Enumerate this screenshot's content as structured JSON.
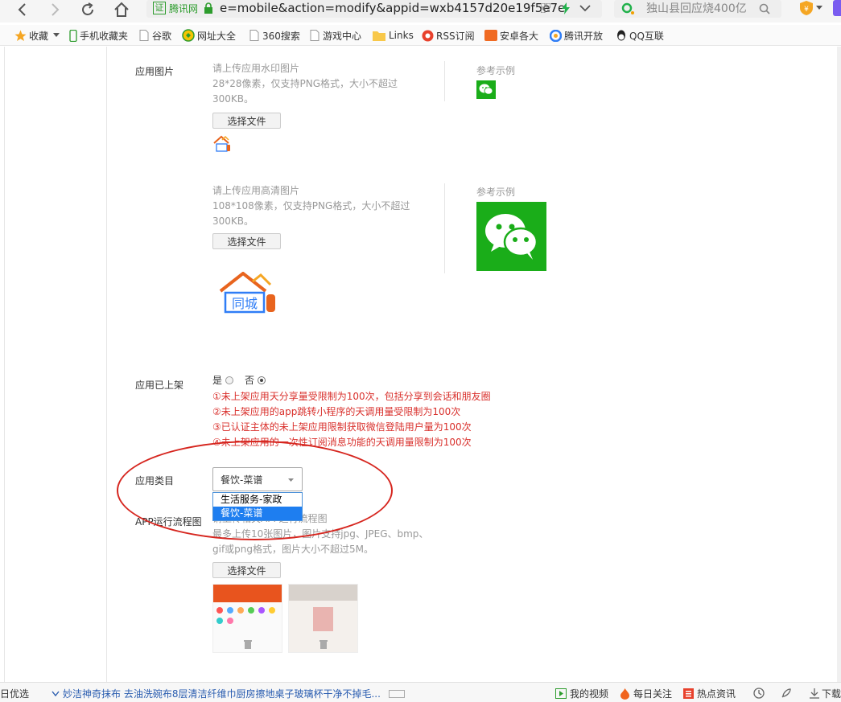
{
  "toolbar": {
    "address_cert_label": "证",
    "address_site": "腾讯网",
    "address_url": "e=mobile&action=modify&appid=wxb4157d20e19f5e7e",
    "search_text": "独山县回应烧400亿"
  },
  "bookmarks": [
    {
      "label": "收藏",
      "icon": "star-icon"
    },
    {
      "label": "手机收藏夹",
      "icon": "phone-icon"
    },
    {
      "label": "谷歌",
      "icon": "page-icon"
    },
    {
      "label": "网址大全",
      "icon": "globe-icon"
    },
    {
      "label": "360搜索",
      "icon": "page-icon"
    },
    {
      "label": "游戏中心",
      "icon": "page-icon"
    },
    {
      "label": "Links",
      "icon": "folder-icon"
    },
    {
      "label": "RSS订阅",
      "icon": "rss-icon"
    },
    {
      "label": "安卓各大",
      "icon": "android-icon"
    },
    {
      "label": "腾讯开放",
      "icon": "tencent-icon"
    },
    {
      "label": "QQ互联",
      "icon": "qq-icon"
    }
  ],
  "form": {
    "app_image": {
      "label": "应用图片",
      "watermark": {
        "hint_line1": "请上传应用水印图片",
        "hint_line2": "28*28像素，仅支持PNG格式，大小不超过",
        "hint_line3": "300KB。",
        "button": "选择文件",
        "example_label": "参考示例"
      },
      "hd": {
        "hint_line1": "请上传应用高清图片",
        "hint_line2": "108*108像素，仅支持PNG格式，大小不超过",
        "hint_line3": "300KB。",
        "button": "选择文件",
        "example_label": "参考示例",
        "logo_text": "同城"
      }
    },
    "app_listed": {
      "label": "应用已上架",
      "option_yes": "是",
      "option_no": "否",
      "selected": "否",
      "notes": [
        "①未上架应用天分享量受限制为100次，包括分享到会话和朋友圈",
        "②未上架应用的app跳转小程序的天调用量受限制为100次",
        "③已认证主体的未上架应用限制获取微信登陆用户量为100次",
        "④未上架应用的一次性订阅消息功能的天调用量限制为100次"
      ]
    },
    "app_category": {
      "label": "应用类目",
      "value": "餐饮-菜谱",
      "options": [
        "生活服务-家政",
        "餐饮-菜谱"
      ],
      "selected_index": 1
    },
    "app_flow": {
      "label": "APP运行流程图",
      "hint_line1": "请上传相关APP运行流程图",
      "hint_line2": "最多上传10张图片，图片支持jpg、JPEG、bmp、",
      "hint_line3": "gif或png格式，图片大小不超过5M。",
      "button": "选择文件"
    }
  },
  "statusbar": {
    "left_text": "日优选",
    "news_text": "妙洁神奇抹布 去油洗碗布8层清洁纤维巾厨房擦地桌子玻璃杯干净不掉毛...",
    "my_video": "我的视频",
    "daily_follow": "每日关注",
    "hot_news": "热点资讯",
    "download": "下载"
  },
  "colors": {
    "accent_green": "#1aad19",
    "warning_red": "#d9302c",
    "selection_blue": "#1e7ef0"
  }
}
